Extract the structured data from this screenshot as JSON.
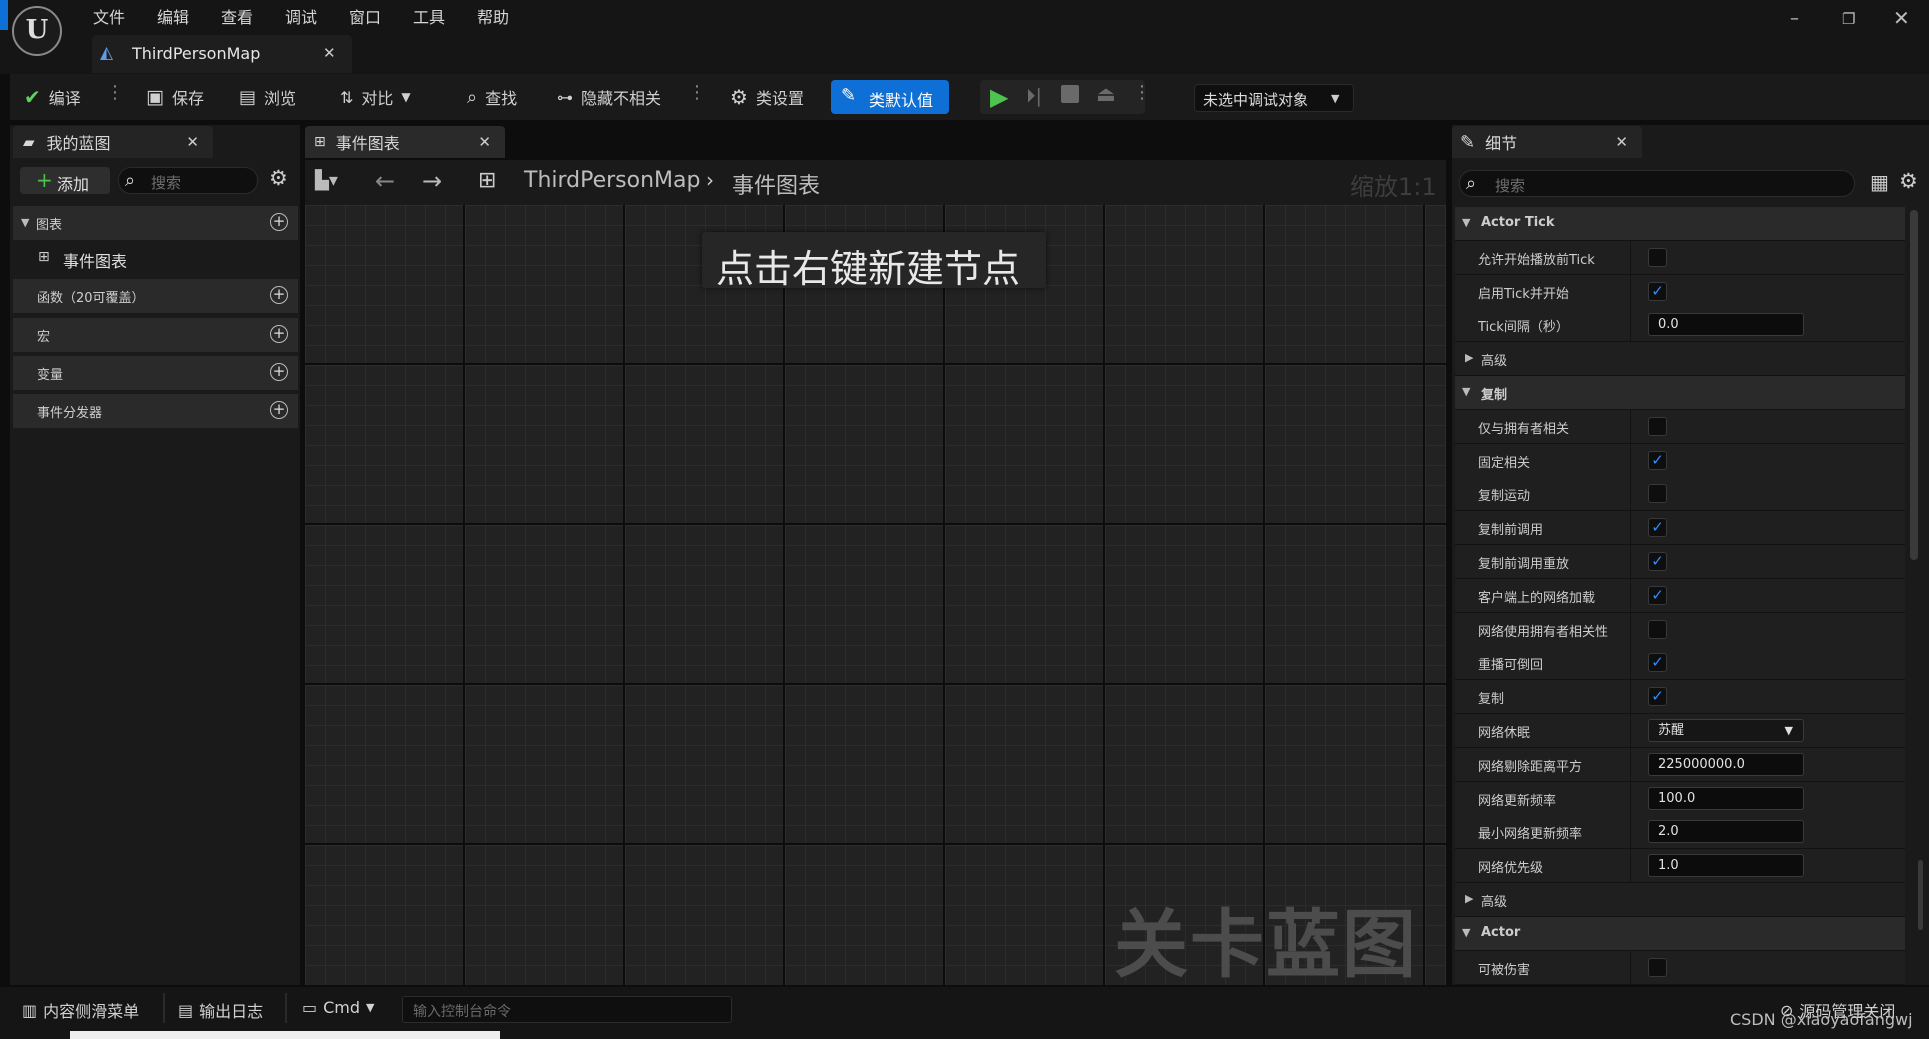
{
  "window": {
    "menu": [
      "文件",
      "编辑",
      "查看",
      "调试",
      "窗口",
      "工具",
      "帮助"
    ],
    "doc_tab": "ThirdPersonMap"
  },
  "toolbar": {
    "compile": "编译",
    "save": "保存",
    "browse": "浏览",
    "diff": "对比",
    "find": "查找",
    "hide_unrelated": "隐藏不相关",
    "class_settings": "类设置",
    "class_defaults": "类默认值",
    "debug_target": "未选中调试对象"
  },
  "my_blueprint": {
    "tab": "我的蓝图",
    "add": "添加",
    "search_placeholder": "搜索",
    "graphs_header": "图表",
    "event_graph_item": "事件图表",
    "functions": "函数（20可覆盖）",
    "macros": "宏",
    "variables": "变量",
    "dispatchers": "事件分发器"
  },
  "graph": {
    "tab": "事件图表",
    "breadcrumb_root": "ThirdPersonMap",
    "breadcrumb_current": "事件图表",
    "zoom": "缩放1:1",
    "hint": "点击右键新建节点",
    "watermark": "关卡蓝图"
  },
  "details": {
    "tab": "细节",
    "search_placeholder": "搜索",
    "rows": [
      {
        "type": "header",
        "label": "Actor Tick",
        "expanded": true
      },
      {
        "type": "bool",
        "label": "允许开始播放前Tick",
        "checked": false
      },
      {
        "type": "bool",
        "label": "启用Tick并开始",
        "checked": true
      },
      {
        "type": "text",
        "label": "Tick间隔（秒）",
        "value": "0.0"
      },
      {
        "type": "sub",
        "label": "高级",
        "expanded": false
      },
      {
        "type": "header",
        "label": "复制",
        "expanded": true
      },
      {
        "type": "bool",
        "label": "仅与拥有者相关",
        "checked": false
      },
      {
        "type": "bool",
        "label": "固定相关",
        "checked": true
      },
      {
        "type": "bool",
        "label": "复制运动",
        "checked": false
      },
      {
        "type": "bool",
        "label": "复制前调用",
        "checked": true
      },
      {
        "type": "bool",
        "label": "复制前调用重放",
        "checked": true
      },
      {
        "type": "bool",
        "label": "客户端上的网络加载",
        "checked": true
      },
      {
        "type": "bool",
        "label": "网络使用拥有者相关性",
        "checked": false
      },
      {
        "type": "bool",
        "label": "重播可倒回",
        "checked": true
      },
      {
        "type": "bool",
        "label": "复制",
        "checked": true
      },
      {
        "type": "select",
        "label": "网络休眠",
        "value": "苏醒"
      },
      {
        "type": "text",
        "label": "网络剔除距离平方",
        "value": "225000000.0"
      },
      {
        "type": "text",
        "label": "网络更新频率",
        "value": "100.0"
      },
      {
        "type": "text",
        "label": "最小网络更新频率",
        "value": "2.0"
      },
      {
        "type": "text",
        "label": "网络优先级",
        "value": "1.0"
      },
      {
        "type": "sub",
        "label": "高级",
        "expanded": false
      },
      {
        "type": "header",
        "label": "Actor",
        "expanded": true
      },
      {
        "type": "bool",
        "label": "可被伤害",
        "checked": false
      }
    ]
  },
  "bottom": {
    "content_drawer": "内容侧滑菜单",
    "output_log": "输出日志",
    "cmd": "Cmd",
    "console_placeholder": "输入控制台命令",
    "source_control": "源码管理关闭",
    "credit": "CSDN @xiaoyaofangwj"
  },
  "colors": {
    "accent_blue": "#0e6fd6",
    "check_blue": "#2f8dff",
    "play_green": "#4ec34e"
  }
}
